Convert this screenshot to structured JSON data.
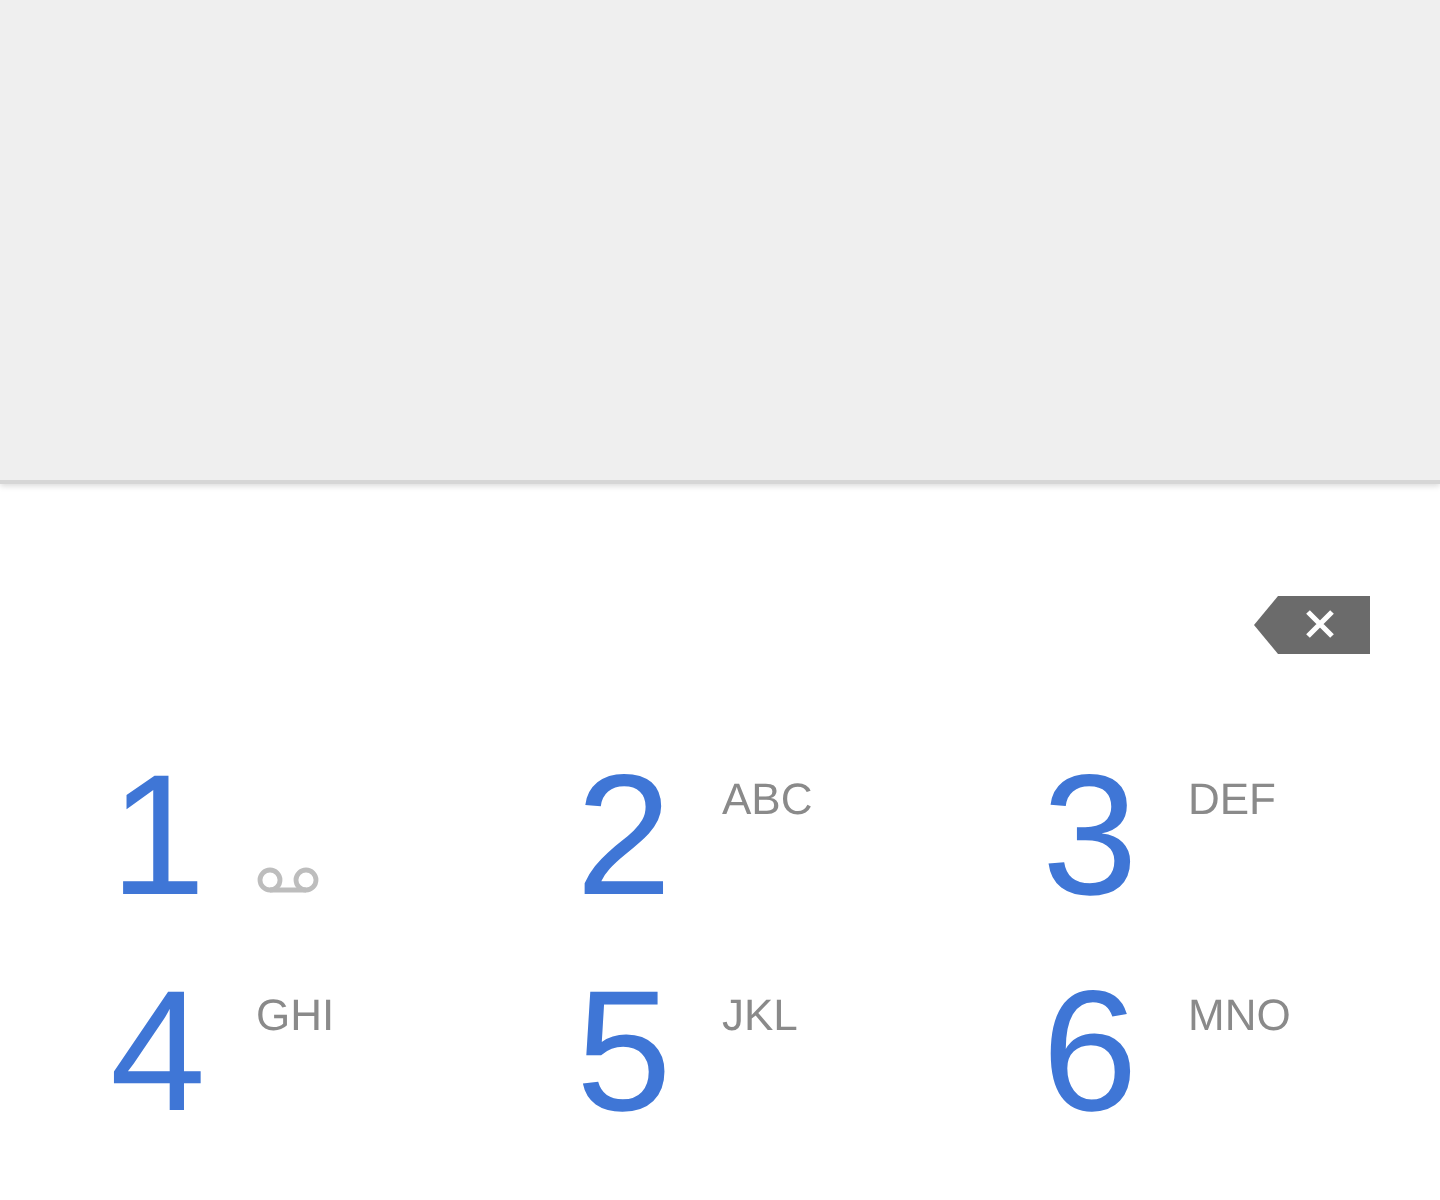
{
  "keys": [
    {
      "digit": "1",
      "kind": "voicemail"
    },
    {
      "digit": "2",
      "kind": "letters",
      "letters": "ABC"
    },
    {
      "digit": "3",
      "kind": "letters",
      "letters": "DEF"
    },
    {
      "digit": "4",
      "kind": "letters",
      "letters": "GHI"
    },
    {
      "digit": "5",
      "kind": "letters",
      "letters": "JKL"
    },
    {
      "digit": "6",
      "kind": "letters",
      "letters": "MNO"
    }
  ]
}
